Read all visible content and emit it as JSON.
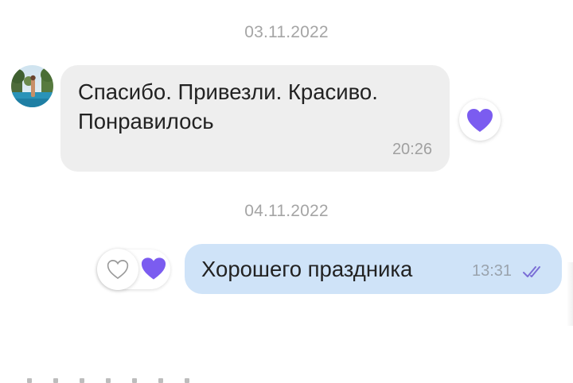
{
  "chat": {
    "date_1": "03.11.2022",
    "incoming_message": {
      "text": "Спасибо. Привезли. Красиво. Понравилось",
      "time": "20:26",
      "reaction_icon": "purple-heart-icon"
    },
    "date_2": "04.11.2022",
    "outgoing_message": {
      "text": "Хорошего праздника",
      "time": "13:31",
      "status_icon": "double-check-icon",
      "reactions": [
        "heart-outline-icon",
        "purple-heart-icon"
      ]
    }
  },
  "colors": {
    "incoming_bubble": "#eeeeee",
    "outgoing_bubble": "#cfe3f8",
    "accent_purple": "#7b5cf0",
    "date_text": "#a5a5a5"
  }
}
